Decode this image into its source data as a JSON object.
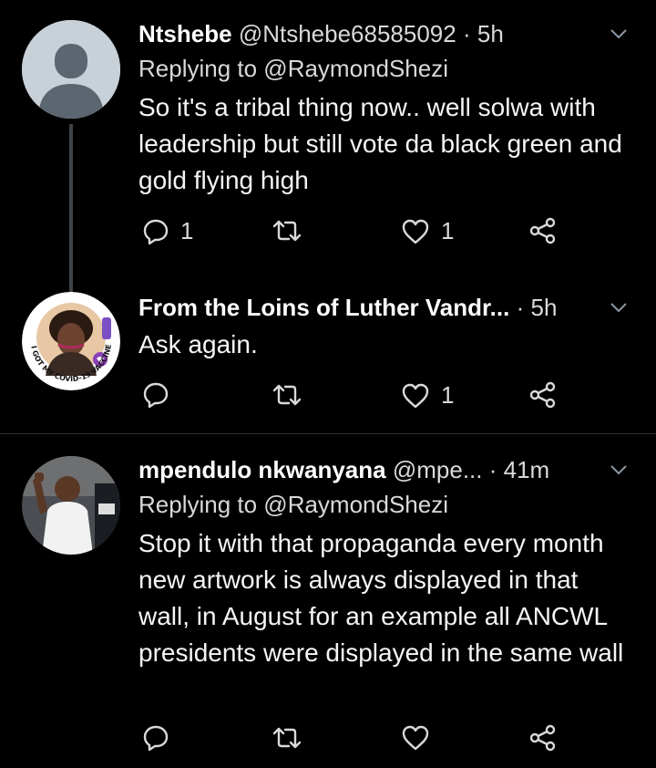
{
  "tweets": [
    {
      "name": "Ntshebe",
      "handle": "@Ntshebe68585092",
      "dot": "·",
      "time": "5h",
      "replying": "Replying to @RaymondShezi",
      "text": "So it's a tribal thing now.. well solwa with leadership but still vote da black green and gold flying high",
      "reply_count": "1",
      "retweet_count": "",
      "like_count": "1"
    },
    {
      "name": "From the Loins of Luther Vandr...",
      "handle": "",
      "dot": "·",
      "time": "5h",
      "replying": "",
      "text": "Ask again.",
      "reply_count": "",
      "retweet_count": "",
      "like_count": "1",
      "badge_text": "I GOT MY COVID-19 VACCINE",
      "badge_side": "UNICEF"
    },
    {
      "name": "mpendulo nkwanyana",
      "handle": "@mpe...",
      "dot": "·",
      "time": "41m",
      "replying": "Replying to @RaymondShezi",
      "text": "Stop it with that propaganda every month new artwork is always displayed in that wall, in August for an example all ANCWL presidents were displayed in the same wall",
      "reply_count": "",
      "retweet_count": "",
      "like_count": ""
    }
  ],
  "colors": {
    "background": "#000000",
    "text": "#d9d9d9",
    "divider": "#2f3336"
  }
}
